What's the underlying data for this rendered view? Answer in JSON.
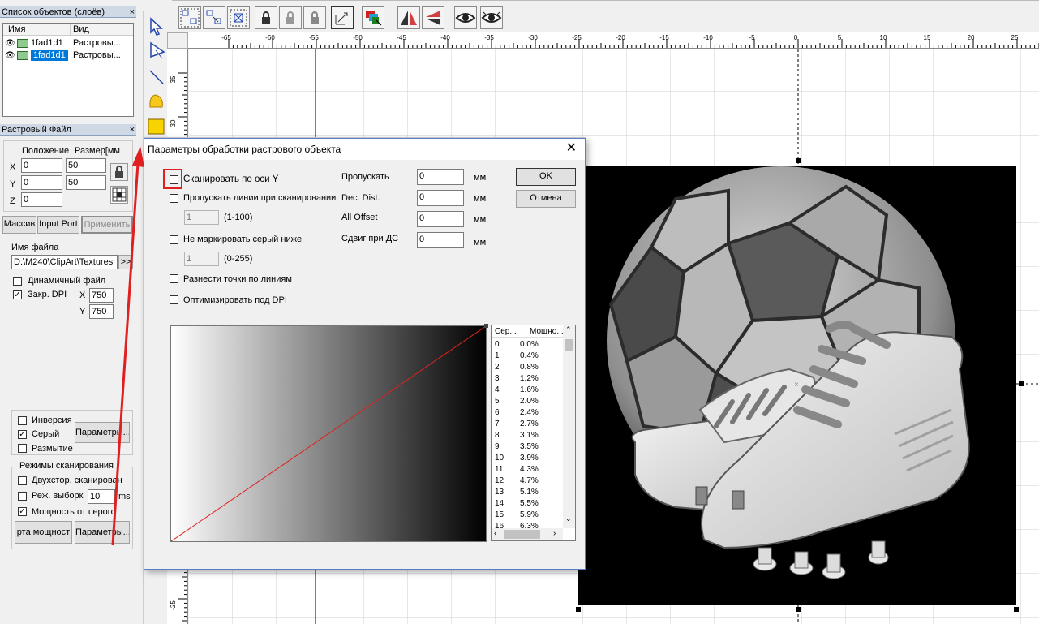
{
  "layers_panel": {
    "title": "Список объектов (слоёв)",
    "close": "×",
    "col_name": "Имя",
    "col_type": "Вид",
    "rows": [
      {
        "name": "1fad1d1",
        "type": "Растровы..."
      },
      {
        "name": "1fad1d1",
        "type": "Растровы..."
      }
    ]
  },
  "raster_panel": {
    "title": "Растровый Файл",
    "close": "×",
    "position_label": "Положение",
    "size_label": "Размер[мм",
    "x_label": "X",
    "y_label": "Y",
    "z_label": "Z",
    "x_pos": "0",
    "y_pos": "0",
    "z_pos": "0",
    "x_size": "50",
    "y_size": "50",
    "btn_array": "Массив",
    "btn_input_port": "Input Port",
    "btn_apply": "Применить",
    "filename_label": "Имя файла",
    "filename": "D:\\M240\\ClipArt\\Textures",
    "browse": ">>",
    "dynamic_file": "Динамичный файл",
    "fixed_dpi": "Закр. DPI",
    "dpi_x_label": "X",
    "dpi_y_label": "Y",
    "dpi_x": "750",
    "dpi_y": "750",
    "inversion": "Инверсия",
    "gray": "Серый",
    "blur": "Размытие",
    "params_btn": "Параметры...",
    "scan_modes": "Режимы сканирования",
    "bidir": "Двухстор. сканирован",
    "sample_mode": "Реж. выборк",
    "sample_ms_value": "10",
    "ms": "ms",
    "power_from_gray": "Мощность от серого",
    "power_map_btn": "рта мощност",
    "params_btn2": "Параметры..."
  },
  "rulers": {
    "h_ticks": [
      "-65",
      "-60",
      "-55",
      "-50",
      "-45",
      "-40",
      "-35",
      "-30",
      "-25",
      "-20",
      "-15",
      "-10",
      "-5",
      "0",
      "5",
      "10",
      "15",
      "20",
      "25"
    ],
    "v_ticks": [
      "35",
      "30",
      "25",
      "20",
      "15",
      "10",
      "5",
      "0",
      "-5",
      "-10",
      "-15",
      "-20",
      "-25"
    ]
  },
  "dialog": {
    "title": "Параметры обработки растрового объекта",
    "close": "✕",
    "scan_y": "Сканировать по оси Y",
    "skip_lines": "Пропускать линии при сканировании",
    "skip_lines_value": "1",
    "skip_lines_range": "(1-100)",
    "no_mark_gray": "Не маркировать серый ниже",
    "no_mark_value": "1",
    "no_mark_range": "(0-255)",
    "spread_points": "Разнести точки по линиям",
    "optimize_dpi": "Оптимизировать под DPI",
    "skip_label": "Пропускать",
    "skip_value": "0",
    "dec_dist_label": "Dec. Dist.",
    "dec_dist_value": "0",
    "all_offset_label": "All Offset",
    "all_offset_value": "0",
    "ds_shift_label": "Сдвиг при ДС",
    "ds_shift_value": "0",
    "unit": "мм",
    "ok": "OK",
    "cancel": "Отмена",
    "table": {
      "col_gray": "Сер...",
      "col_power": "Мощно...",
      "rows": [
        [
          "0",
          "0.0%"
        ],
        [
          "1",
          "0.4%"
        ],
        [
          "2",
          "0.8%"
        ],
        [
          "3",
          "1.2%"
        ],
        [
          "4",
          "1.6%"
        ],
        [
          "5",
          "2.0%"
        ],
        [
          "6",
          "2.4%"
        ],
        [
          "7",
          "2.7%"
        ],
        [
          "8",
          "3.1%"
        ],
        [
          "9",
          "3.5%"
        ],
        [
          "10",
          "3.9%"
        ],
        [
          "11",
          "4.3%"
        ],
        [
          "12",
          "4.7%"
        ],
        [
          "13",
          "5.1%"
        ],
        [
          "14",
          "5.5%"
        ],
        [
          "15",
          "5.9%"
        ],
        [
          "16",
          "6.3%"
        ]
      ]
    }
  },
  "colors": {
    "accent_red": "#e02020",
    "selection_blue": "#0078d7"
  }
}
